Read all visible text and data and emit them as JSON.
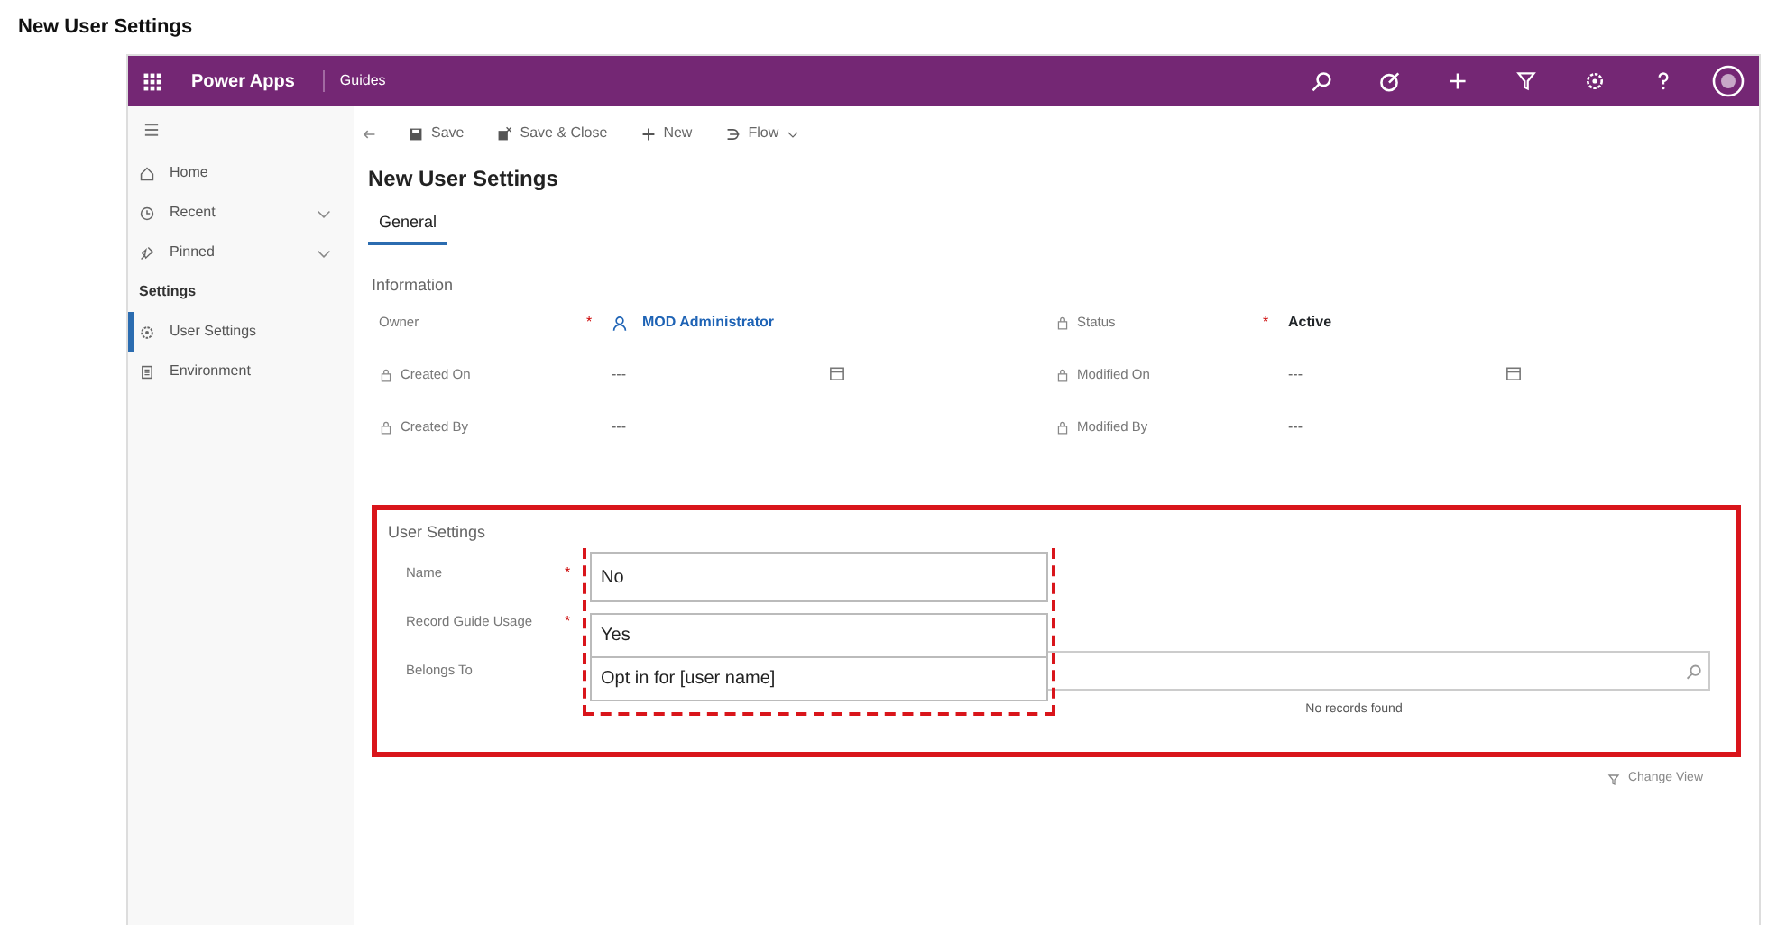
{
  "page_title": "New User Settings",
  "topbar": {
    "app": "Power Apps",
    "area": "Guides"
  },
  "sidebar": {
    "items": [
      {
        "kind": "item",
        "label": "Home",
        "expandable": false,
        "selected": false
      },
      {
        "kind": "item",
        "label": "Recent",
        "expandable": true,
        "selected": false
      },
      {
        "kind": "item",
        "label": "Pinned",
        "expandable": true,
        "selected": false
      },
      {
        "kind": "header",
        "label": "Settings"
      },
      {
        "kind": "item",
        "label": "User Settings",
        "expandable": false,
        "selected": true
      },
      {
        "kind": "item",
        "label": "Environment",
        "expandable": false,
        "selected": false
      }
    ]
  },
  "commands": [
    {
      "kind": "icon"
    },
    {
      "kind": "button",
      "label": "Save"
    },
    {
      "kind": "button",
      "label": "Save & Close"
    },
    {
      "kind": "button",
      "label": "New"
    },
    {
      "kind": "button",
      "label": "Flow",
      "dropdown": true
    }
  ],
  "form_title": "New User Settings",
  "tabs": [
    {
      "label": "General",
      "selected": true
    }
  ],
  "information": {
    "title": "Information",
    "left": [
      {
        "label": "Owner",
        "locked": false,
        "required_mark": "*",
        "kind": "link",
        "value": "MOD Administrator"
      },
      {
        "label": "Created On",
        "locked": true,
        "kind": "date",
        "value": "---"
      },
      {
        "label": "Created By",
        "locked": true,
        "kind": "text",
        "value": "---"
      }
    ],
    "right": [
      {
        "label": "Status",
        "locked": true,
        "required_mark": "*",
        "kind": "bold",
        "value": "Active"
      },
      {
        "label": "Modified On",
        "locked": true,
        "kind": "date",
        "value": "---"
      },
      {
        "label": "Modified By",
        "locked": true,
        "kind": "text",
        "value": "---"
      }
    ]
  },
  "user_settings": {
    "title": "User Settings",
    "fields": [
      {
        "label": "Name",
        "required_mark": "*"
      },
      {
        "label": "Record Guide Usage",
        "required_mark": "*"
      },
      {
        "label": "Belongs To"
      }
    ],
    "dropdown_options": [
      "No",
      "Yes",
      "Opt in for [user name]"
    ],
    "no_records": "No records found"
  },
  "change_view": "Change View"
}
